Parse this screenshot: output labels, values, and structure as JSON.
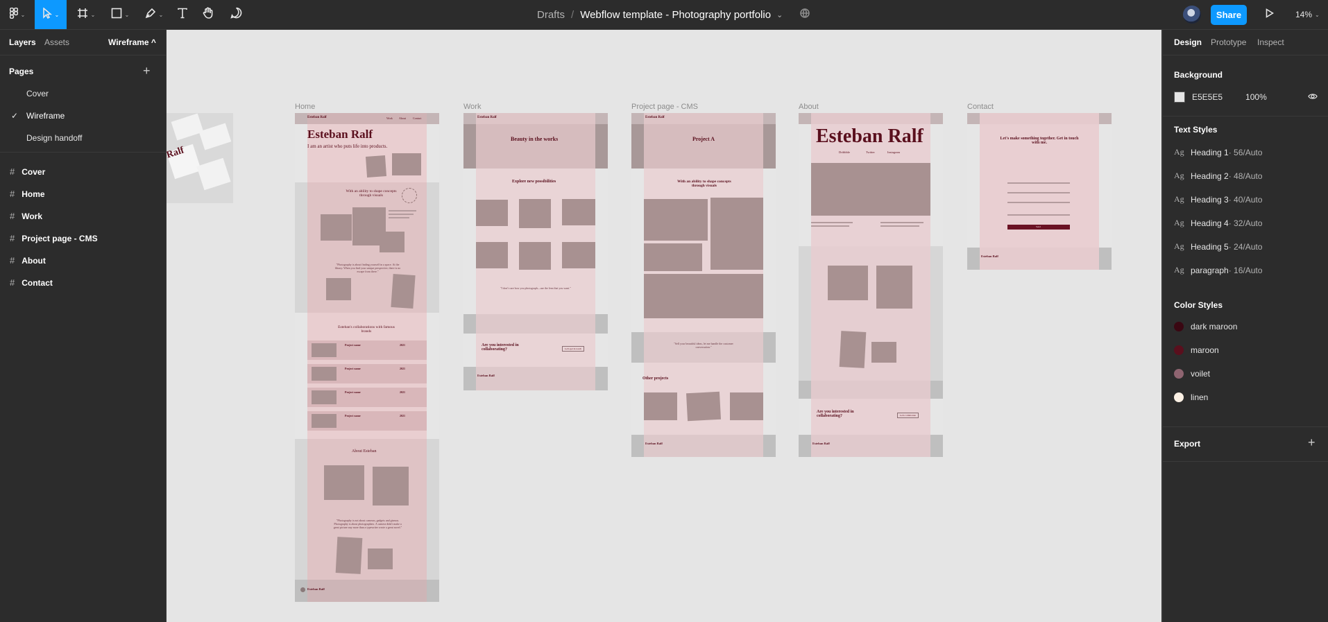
{
  "toolbar": {
    "chevron": "⌄"
  },
  "file": {
    "project": "Drafts",
    "separator": "/",
    "name": "Webflow template - Photography portfolio",
    "chevron": "⌄"
  },
  "actions": {
    "share": "Share",
    "zoom": "14%"
  },
  "left": {
    "tabs": {
      "layers": "Layers",
      "assets": "Assets",
      "page_selector": "Wireframe ^"
    },
    "pages_title": "Pages",
    "add": "+",
    "pages": [
      {
        "label": "Cover"
      },
      {
        "label": "Wireframe",
        "check": "✓"
      },
      {
        "label": "Design handoff"
      }
    ],
    "layers": [
      {
        "hash": "#",
        "label": "Cover"
      },
      {
        "hash": "#",
        "label": "Home"
      },
      {
        "hash": "#",
        "label": "Work"
      },
      {
        "hash": "#",
        "label": "Project page - CMS"
      },
      {
        "hash": "#",
        "label": "About"
      },
      {
        "hash": "#",
        "label": "Contact"
      }
    ]
  },
  "canvas": {
    "frames": {
      "home": "Home",
      "work": "Work",
      "project": "Project page - CMS",
      "about": "About",
      "contact": "Contact"
    },
    "home": {
      "logo": "Esteban Ralf",
      "nav1": "Work",
      "nav2": "About",
      "nav3": "Contact",
      "title": "Esteban Ralf",
      "subtitle": "I am an artist who puts life into products.",
      "ability": "With an ability to shape concepts through visuals",
      "quote": "\"Photography is about finding yourself in a space. At the library. When you find your unique perspective, there is no escape from there.\"",
      "collab": "Esteban's collaborations with famous brands",
      "project_name": "Project name",
      "year": "2021",
      "about": "About Esteban",
      "quote2": "\"Photography is not about cameras, gadgets and gizmos. Photography is about photographers. A camera didn't make a great picture any more than a typewriter wrote a great novel.\""
    },
    "work": {
      "logo": "Esteban Ralf",
      "title": "Beauty in the works",
      "explore": "Explore new possibilities",
      "cta": "Are you interested in collaborating?",
      "btn": "Let's get in touch",
      "quote": "\"I don't care how you photograph—use the lens that you want.\""
    },
    "project": {
      "logo": "Esteban Ralf",
      "title": "Project A",
      "ability": "With an ability to shape concepts through visuals",
      "other": "Other projects",
      "quote": "\"Sell your beautiful ideas, let me handle the customer conversation.\""
    },
    "about": {
      "title": "Esteban Ralf",
      "link1": "Dribbble",
      "link2": "Twitter",
      "link3": "Instagram",
      "cta": "Are you interested in collaborating?",
      "btn": "Let's collaborate",
      "logo": "Esteban Ralf"
    },
    "contact": {
      "title": "Let's make something together. Get in touch with me.",
      "button": "Send",
      "logo": "Esteban Ralf"
    }
  },
  "right": {
    "tabs": {
      "design": "Design",
      "prototype": "Prototype",
      "inspect": "Inspect"
    },
    "background": {
      "title": "Background",
      "hex": "E5E5E5",
      "opacity": "100%",
      "color": "#e5e5e5"
    },
    "text_styles_title": "Text Styles",
    "ag": "Ag",
    "text_styles": [
      {
        "name": "Heading 1",
        "size": " · 56/Auto"
      },
      {
        "name": "Heading 2",
        "size": " · 48/Auto"
      },
      {
        "name": "Heading 3",
        "size": " · 40/Auto"
      },
      {
        "name": "Heading 4",
        "size": " · 32/Auto"
      },
      {
        "name": "Heading 5",
        "size": " · 24/Auto"
      },
      {
        "name": "paragraph",
        "size": " · 16/Auto"
      }
    ],
    "color_styles_title": "Color Styles",
    "color_styles": [
      {
        "name": "dark maroon",
        "color": "#3a0712"
      },
      {
        "name": "maroon",
        "color": "#5a0f1d"
      },
      {
        "name": "voilet",
        "color": "#8e6470"
      },
      {
        "name": "linen",
        "color": "#fbf0e4"
      }
    ],
    "export": "Export",
    "add": "+"
  }
}
